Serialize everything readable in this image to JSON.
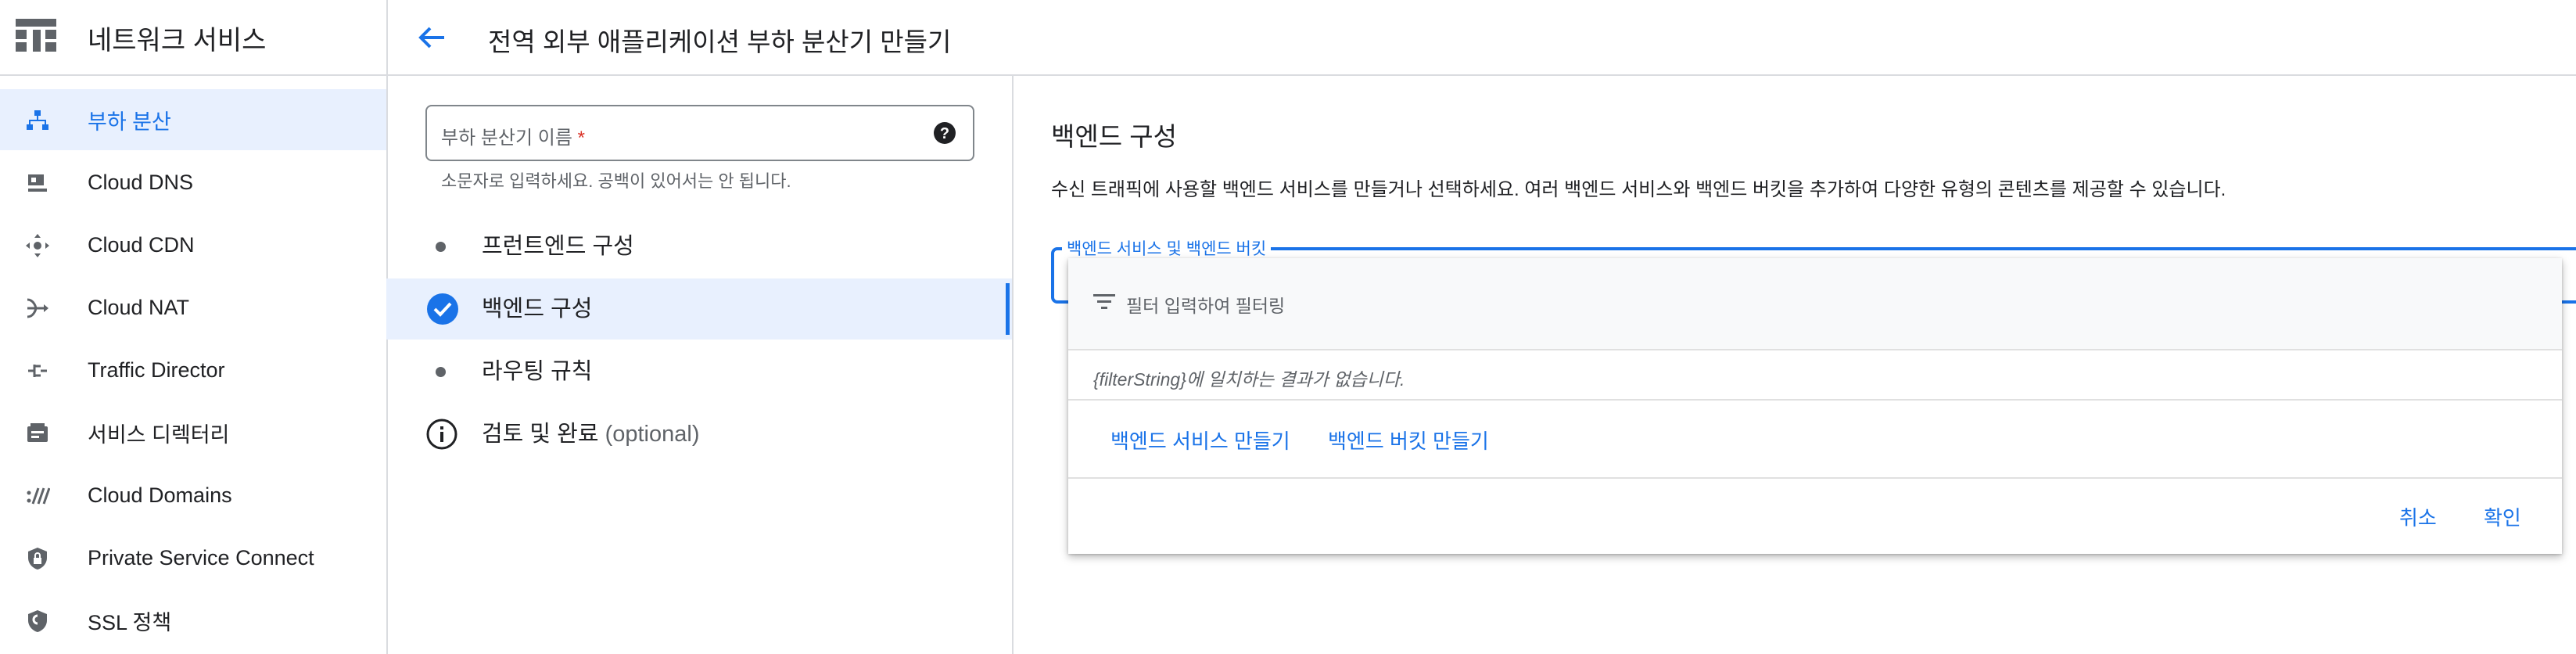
{
  "app": {
    "title": "네트워크 서비스"
  },
  "sidebar": {
    "items": [
      {
        "label": "부하 분산",
        "icon": "load-balancing-icon",
        "active": true
      },
      {
        "label": "Cloud DNS",
        "icon": "dns-icon"
      },
      {
        "label": "Cloud CDN",
        "icon": "cdn-icon"
      },
      {
        "label": "Cloud NAT",
        "icon": "nat-icon"
      },
      {
        "label": "Traffic Director",
        "icon": "traffic-director-icon"
      },
      {
        "label": "서비스 디렉터리",
        "icon": "service-directory-icon"
      },
      {
        "label": "Cloud Domains",
        "icon": "domains-icon"
      },
      {
        "label": "Private Service Connect",
        "icon": "private-service-connect-icon"
      },
      {
        "label": "SSL 정책",
        "icon": "ssl-policy-icon"
      }
    ]
  },
  "header": {
    "title": "전역 외부 애플리케이션 부하 분산기 만들기"
  },
  "form": {
    "name_label": "부하 분산기 이름",
    "required_mark": "*",
    "name_hint": "소문자로 입력하세요. 공백이 있어서는 안 됩니다."
  },
  "steps": [
    {
      "label": "프런트엔드 구성",
      "icon": "bullet"
    },
    {
      "label": "백엔드 구성",
      "icon": "check-circle",
      "active": true
    },
    {
      "label": "라우팅 규칙",
      "icon": "bullet"
    },
    {
      "label": "검토 및 완료",
      "optional": "(optional)",
      "icon": "info"
    }
  ],
  "backend": {
    "title": "백엔드 구성",
    "description": "수신 트래픽에 사용할 백엔드 서비스를 만들거나 선택하세요. 여러 백엔드 서비스와 백엔드 버킷을 추가하여 다양한 유형의 콘텐츠를 제공할 수 있습니다.",
    "field_label": "백엔드 서비스 및 백엔드 버킷",
    "dropdown": {
      "filter_placeholder": "필터 입력하여 필터링",
      "no_results": "{filterString}에 일치하는 결과가 없습니다.",
      "create_service": "백엔드 서비스 만들기",
      "create_bucket": "백엔드 버킷 만들기",
      "cancel": "취소",
      "confirm": "확인"
    }
  },
  "colors": {
    "accent": "#1a73e8",
    "active_bg": "#e8f0fe",
    "divider": "#dadce0"
  }
}
